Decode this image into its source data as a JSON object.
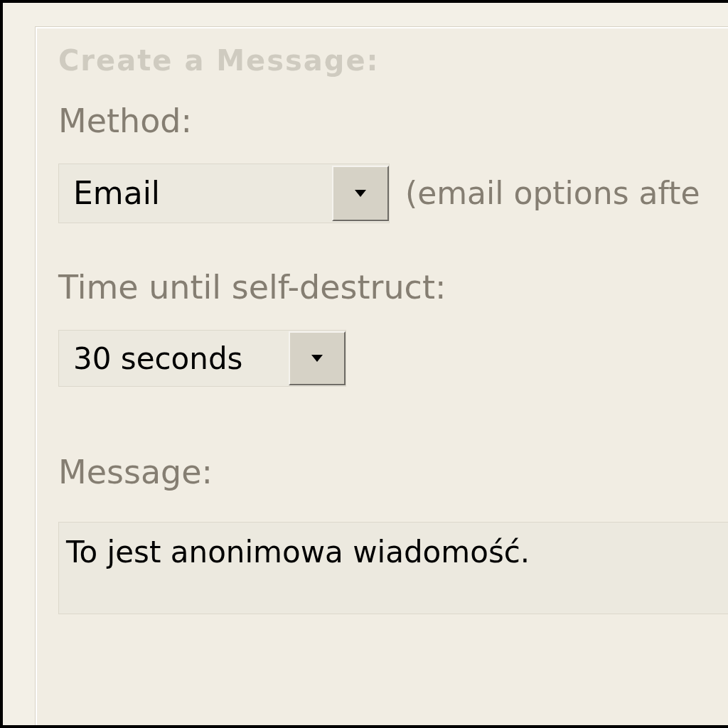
{
  "heading": "Create a Message:",
  "method": {
    "label": "Method:",
    "value": "Email",
    "note": "(email options afte"
  },
  "timer": {
    "label": "Time until self-destruct:",
    "value": "30 seconds"
  },
  "message": {
    "label": "Message:",
    "value": "To jest anonimowa wiadomość."
  }
}
